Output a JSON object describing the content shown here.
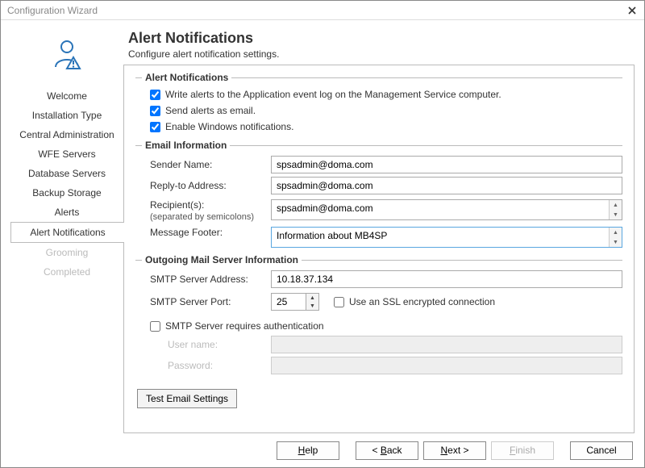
{
  "window": {
    "title": "Configuration Wizard"
  },
  "header": {
    "title": "Alert Notifications",
    "subtitle": "Configure alert notification settings."
  },
  "sidebar": {
    "items": [
      {
        "label": "Welcome",
        "state": "normal"
      },
      {
        "label": "Installation Type",
        "state": "normal"
      },
      {
        "label": "Central Administration",
        "state": "normal"
      },
      {
        "label": "WFE Servers",
        "state": "normal"
      },
      {
        "label": "Database Servers",
        "state": "normal"
      },
      {
        "label": "Backup Storage",
        "state": "normal"
      },
      {
        "label": "Alerts",
        "state": "normal"
      },
      {
        "label": "Alert Notifications",
        "state": "active"
      },
      {
        "label": "Grooming",
        "state": "disabled"
      },
      {
        "label": "Completed",
        "state": "disabled"
      }
    ]
  },
  "groups": {
    "alerts_title": "Alert Notifications",
    "email_title": "Email Information",
    "smtp_title": "Outgoing Mail Server Information"
  },
  "alerts": {
    "write_log": "Write alerts to the Application event log on the Management Service computer.",
    "send_email": "Send alerts as email.",
    "enable_windows": "Enable Windows notifications."
  },
  "email": {
    "sender_label": "Sender Name:",
    "sender_value": "spsadmin@doma.com",
    "reply_label": "Reply-to Address:",
    "reply_value": "spsadmin@doma.com",
    "recipients_label": "Recipient(s):",
    "recipients_sub": "(separated by semicolons)",
    "recipients_value": "spsadmin@doma.com",
    "footer_label": "Message Footer:",
    "footer_value": "Information about MB4SP"
  },
  "smtp": {
    "address_label": "SMTP Server Address:",
    "address_value": "10.18.37.134",
    "port_label": "SMTP Server Port:",
    "port_value": "25",
    "ssl_label": "Use an SSL encrypted connection",
    "auth_label": "SMTP Server requires authentication",
    "user_label": "User name:",
    "pass_label": "Password:"
  },
  "buttons": {
    "test": "Test Email Settings",
    "help": "Help",
    "back": "< Back",
    "next": "Next >",
    "finish": "Finish",
    "cancel": "Cancel"
  }
}
